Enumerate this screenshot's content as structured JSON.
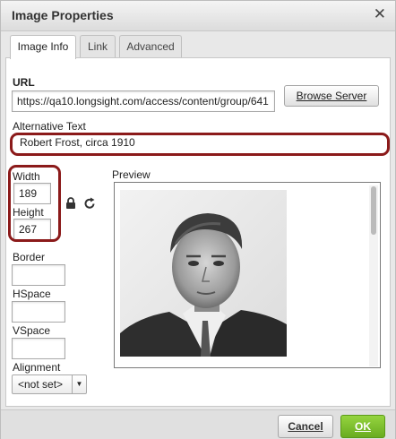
{
  "dialog": {
    "title": "Image Properties",
    "close_symbol": "✕"
  },
  "tabs": [
    {
      "label": "Image Info",
      "active": true
    },
    {
      "label": "Link",
      "active": false
    },
    {
      "label": "Advanced",
      "active": false
    }
  ],
  "url": {
    "label": "URL",
    "value": "https://qa10.longsight.com/access/content/group/641",
    "browse_label": "Browse Server"
  },
  "alt_text": {
    "label": "Alternative Text",
    "value": "Robert Frost, circa 1910"
  },
  "width": {
    "label": "Width",
    "value": "189"
  },
  "height": {
    "label": "Height",
    "value": "267"
  },
  "border": {
    "label": "Border",
    "value": ""
  },
  "hspace": {
    "label": "HSpace",
    "value": ""
  },
  "vspace": {
    "label": "VSpace",
    "value": ""
  },
  "alignment": {
    "label": "Alignment",
    "selected": "<not set>"
  },
  "preview": {
    "label": "Preview"
  },
  "icons": {
    "lock": "lock-icon",
    "reset": "reset-size-icon"
  },
  "footer": {
    "cancel_label": "Cancel",
    "ok_label": "OK"
  },
  "colors": {
    "highlight": "#8b1a1a",
    "ok_button": "#7cc02d"
  }
}
